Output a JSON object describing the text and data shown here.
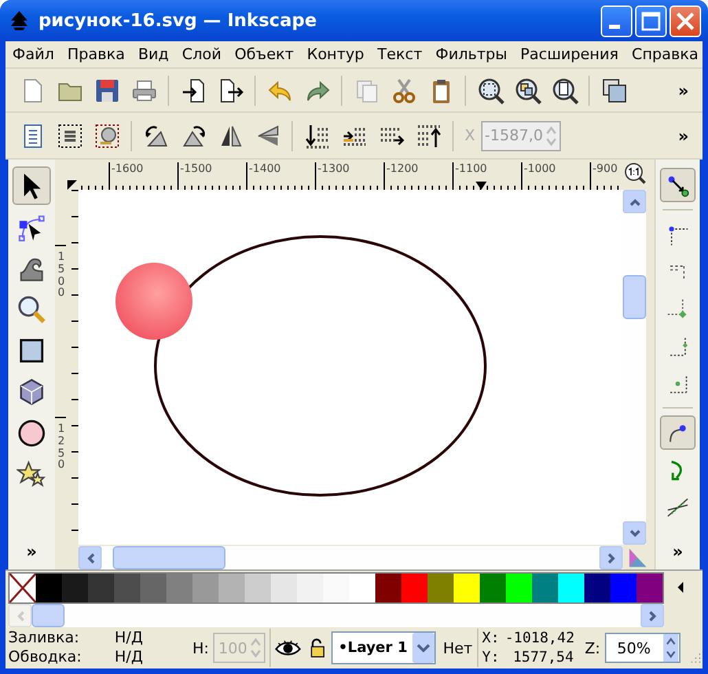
{
  "window": {
    "title": "рисунок-16.svg — Inkscape"
  },
  "menu": [
    {
      "label": "Файл"
    },
    {
      "label": "Правка"
    },
    {
      "label": "Вид"
    },
    {
      "label": "Слой"
    },
    {
      "label": "Объект"
    },
    {
      "label": "Контур"
    },
    {
      "label": "Текст"
    },
    {
      "label": "Фильтры"
    },
    {
      "label": "Расширения"
    },
    {
      "label": "Справка"
    }
  ],
  "commands_bar": {
    "overflow": "»"
  },
  "transform_bar": {
    "x_label": "X",
    "x_value": "-1587,0",
    "overflow": "»"
  },
  "rulers": {
    "horizontal": [
      "-1600",
      "-1500",
      "-1400",
      "-1300",
      "-1200",
      "-1100",
      "-1000",
      "-900"
    ],
    "vertical": [
      "1500",
      "1250"
    ]
  },
  "toolbox": {
    "tools": [
      {
        "kind": "select",
        "selected": true
      },
      {
        "kind": "node",
        "selected": false
      },
      {
        "kind": "tweak",
        "selected": false
      },
      {
        "kind": "zoom",
        "selected": false
      },
      {
        "kind": "rect",
        "selected": false
      },
      {
        "kind": "box3d",
        "selected": false
      },
      {
        "kind": "ellipse",
        "selected": false
      },
      {
        "kind": "star",
        "selected": false
      }
    ],
    "overflow": "»"
  },
  "snap_bar": {
    "controls": [
      {
        "kind": "snap",
        "selected": true
      },
      {
        "kind": "separator"
      },
      {
        "kind": "bbox",
        "selected": false
      },
      {
        "kind": "edge",
        "selected": false
      },
      {
        "kind": "corner",
        "selected": false
      },
      {
        "kind": "midpoint",
        "selected": false
      },
      {
        "kind": "center",
        "selected": false
      },
      {
        "kind": "separator"
      },
      {
        "kind": "nodes",
        "selected": true
      },
      {
        "kind": "path",
        "selected": false
      },
      {
        "kind": "intersection",
        "selected": false
      }
    ],
    "overflow": "»"
  },
  "palette": [
    {
      "kind": "none"
    },
    {
      "kind": "color",
      "color": "#000000"
    },
    {
      "kind": "color",
      "color": "#1a1a1a"
    },
    {
      "kind": "color",
      "color": "#333333"
    },
    {
      "kind": "color",
      "color": "#4d4d4d"
    },
    {
      "kind": "color",
      "color": "#666666"
    },
    {
      "kind": "color",
      "color": "#808080"
    },
    {
      "kind": "color",
      "color": "#999999"
    },
    {
      "kind": "color",
      "color": "#b3b3b3"
    },
    {
      "kind": "color",
      "color": "#cccccc"
    },
    {
      "kind": "color",
      "color": "#e6e6e6"
    },
    {
      "kind": "color",
      "color": "#f2f2f2"
    },
    {
      "kind": "color",
      "color": "#f9f9f9"
    },
    {
      "kind": "color",
      "color": "#ffffff"
    },
    {
      "kind": "color",
      "color": "#800000"
    },
    {
      "kind": "color",
      "color": "#ff0000"
    },
    {
      "kind": "color",
      "color": "#808000"
    },
    {
      "kind": "color",
      "color": "#ffff00"
    },
    {
      "kind": "color",
      "color": "#008000"
    },
    {
      "kind": "color",
      "color": "#00ff00"
    },
    {
      "kind": "color",
      "color": "#008080"
    },
    {
      "kind": "color",
      "color": "#00ffff"
    },
    {
      "kind": "color",
      "color": "#000080"
    },
    {
      "kind": "color",
      "color": "#0000ff"
    },
    {
      "kind": "color",
      "color": "#800080"
    }
  ],
  "status_bar": {
    "fill_label": "Заливка:",
    "fill_value": "Н/Д",
    "stroke_label": "Обводка:",
    "stroke_value": "Н/Д",
    "h_label": "H:",
    "h_value": "100",
    "layer": "•Layer 1",
    "layer_status": "Нет",
    "x_label": "X:",
    "x_value": "-1018,42",
    "y_label": "Y:",
    "y_value": "1577,54",
    "zoom_label": "Z:",
    "zoom_value": "50%"
  }
}
